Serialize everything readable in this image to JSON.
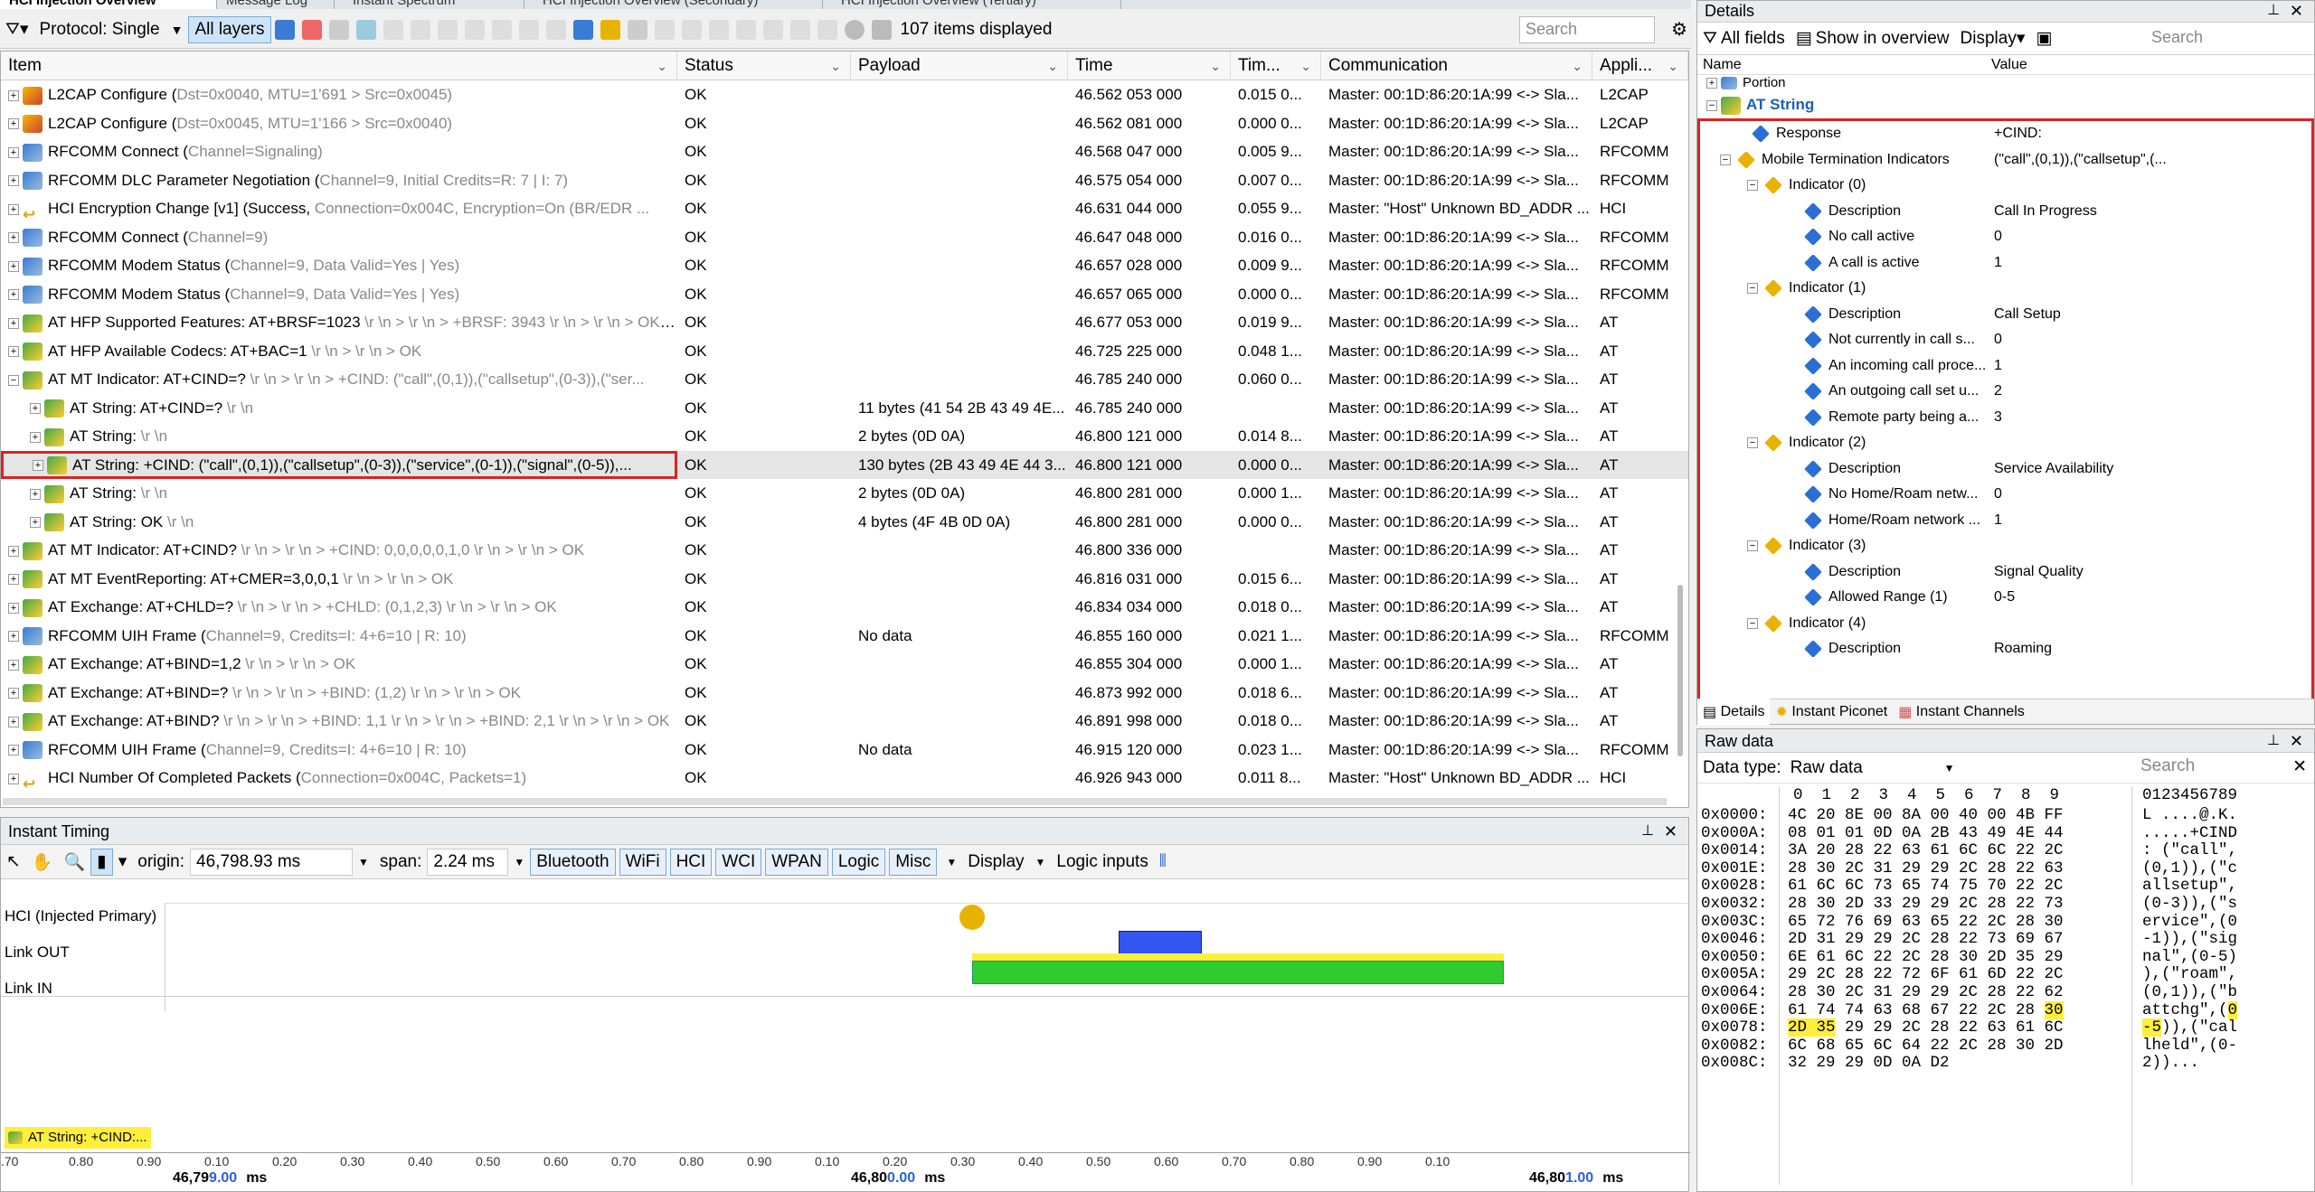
{
  "tabs": [
    "HCI Injection Overview",
    "Message Log",
    "Instant Spectrum",
    "HCI Injection Overview (Secondary)",
    "HCI Injection Overview (Tertiary)"
  ],
  "toolbar": {
    "protocol": "Protocol: Single",
    "all_layers": "All layers",
    "items_displayed": "107 items displayed",
    "search_placeholder": "Search"
  },
  "grid": {
    "headers": [
      "Item",
      "Status",
      "Payload",
      "Time",
      "Tim...",
      "Communication",
      "Appli..."
    ],
    "rows": [
      {
        "icon": "l2",
        "indent": 0,
        "item": "L2CAP Configure (",
        "params": "Dst=0x0040, MTU=1'691 > Src=0x0045)",
        "status": "OK",
        "payload": "",
        "time": "46.562 053 000",
        "delta": "0.015 0...",
        "comm": "Master: 00:1D:86:20:1A:99 <-> Sla...",
        "app": "L2CAP"
      },
      {
        "icon": "l2",
        "indent": 0,
        "item": "L2CAP Configure (",
        "params": "Dst=0x0045, MTU=1'166 > Src=0x0040)",
        "status": "OK",
        "payload": "",
        "time": "46.562 081 000",
        "delta": "0.000 0...",
        "comm": "Master: 00:1D:86:20:1A:99 <-> Sla...",
        "app": "L2CAP"
      },
      {
        "icon": "rf",
        "indent": 0,
        "item": "RFCOMM Connect (",
        "params": "Channel=Signaling)",
        "status": "OK",
        "payload": "",
        "time": "46.568 047 000",
        "delta": "0.005 9...",
        "comm": "Master: 00:1D:86:20:1A:99 <-> Sla...",
        "app": "RFCOMM"
      },
      {
        "icon": "rf",
        "indent": 0,
        "item": "RFCOMM DLC Parameter Negotiation (",
        "params": "Channel=9, Initial Credits=R: 7 | I: 7)",
        "status": "OK",
        "payload": "",
        "time": "46.575 054 000",
        "delta": "0.007 0...",
        "comm": "Master: 00:1D:86:20:1A:99 <-> Sla...",
        "app": "RFCOMM"
      },
      {
        "icon": "hci",
        "indent": 0,
        "item": "HCI Encryption Change [v1] (Success, ",
        "params": "Connection=0x004C, Encryption=On (BR/EDR ...",
        "status": "OK",
        "payload": "",
        "time": "46.631 044 000",
        "delta": "0.055 9...",
        "comm": "Master: \"Host\" Unknown BD_ADDR ...",
        "app": "HCI"
      },
      {
        "icon": "rf",
        "indent": 0,
        "item": "RFCOMM Connect (",
        "params": "Channel=9)",
        "status": "OK",
        "payload": "",
        "time": "46.647 048 000",
        "delta": "0.016 0...",
        "comm": "Master: 00:1D:86:20:1A:99 <-> Sla...",
        "app": "RFCOMM"
      },
      {
        "icon": "rf",
        "indent": 0,
        "item": "RFCOMM Modem Status (",
        "params": "Channel=9, Data Valid=Yes | Yes)",
        "status": "OK",
        "payload": "",
        "time": "46.657 028 000",
        "delta": "0.009 9...",
        "comm": "Master: 00:1D:86:20:1A:99 <-> Sla...",
        "app": "RFCOMM"
      },
      {
        "icon": "rf",
        "indent": 0,
        "item": "RFCOMM Modem Status (",
        "params": "Channel=9, Data Valid=Yes | Yes)",
        "status": "OK",
        "payload": "",
        "time": "46.657 065 000",
        "delta": "0.000 0...",
        "comm": "Master: 00:1D:86:20:1A:99 <-> Sla...",
        "app": "RFCOMM"
      },
      {
        "icon": "at",
        "indent": 0,
        "item": "AT HFP Supported Features: AT+BRSF=1023",
        "params": " \\r \\n > \\r \\n > +BRSF: 3943 \\r \\n > \\r \\n > OK \\r \\n",
        "status": "OK",
        "payload": "",
        "time": "46.677 053 000",
        "delta": "0.019 9...",
        "comm": "Master: 00:1D:86:20:1A:99 <-> Sla...",
        "app": "AT"
      },
      {
        "icon": "at",
        "indent": 0,
        "item": "AT HFP Available Codecs: AT+BAC=1",
        "params": " \\r \\n > \\r \\n > OK",
        "status": "OK",
        "payload": "",
        "time": "46.725 225 000",
        "delta": "0.048 1...",
        "comm": "Master: 00:1D:86:20:1A:99 <-> Sla...",
        "app": "AT"
      },
      {
        "icon": "at",
        "indent": 0,
        "item": "AT MT Indicator: AT+CIND=?",
        "params": " \\r \\n > \\r \\n > +CIND: (\"call\",(0,1)),(\"callsetup\",(0-3)),(\"ser...",
        "status": "OK",
        "payload": "",
        "time": "46.785 240 000",
        "delta": "0.060 0...",
        "comm": "Master: 00:1D:86:20:1A:99 <-> Sla...",
        "app": "AT"
      },
      {
        "icon": "at",
        "indent": 1,
        "item": "AT String: AT+CIND=?",
        "params": " \\r \\n",
        "status": "OK",
        "payload": "11 bytes (41 54 2B 43 49 4E...",
        "time": "46.785 240 000",
        "delta": "",
        "comm": "Master: 00:1D:86:20:1A:99 <-> Sla...",
        "app": "AT"
      },
      {
        "icon": "at",
        "indent": 1,
        "item": "AT String:",
        "params": " \\r \\n",
        "status": "OK",
        "payload": "2 bytes (0D 0A)",
        "time": "46.800 121 000",
        "delta": "0.014 8...",
        "comm": "Master: 00:1D:86:20:1A:99 <-> Sla...",
        "app": "AT"
      },
      {
        "icon": "at",
        "indent": 1,
        "item": "AT String: +CIND: (\"call\",(0,1)),(\"callsetup\",(0-3)),(\"service\",(0-1)),(\"signal\",(0-5)),...",
        "params": "",
        "status": "OK",
        "payload": "130 bytes (2B 43 49 4E 44 3...",
        "time": "46.800 121 000",
        "delta": "0.000 0...",
        "comm": "Master: 00:1D:86:20:1A:99 <-> Sla...",
        "app": "AT",
        "selected": true
      },
      {
        "icon": "at",
        "indent": 1,
        "item": "AT String:",
        "params": " \\r \\n",
        "status": "OK",
        "payload": "2 bytes (0D 0A)",
        "time": "46.800 281 000",
        "delta": "0.000 1...",
        "comm": "Master: 00:1D:86:20:1A:99 <-> Sla...",
        "app": "AT"
      },
      {
        "icon": "at",
        "indent": 1,
        "item": "AT String: OK",
        "params": " \\r \\n",
        "status": "OK",
        "payload": "4 bytes (4F 4B 0D 0A)",
        "time": "46.800 281 000",
        "delta": "0.000 0...",
        "comm": "Master: 00:1D:86:20:1A:99 <-> Sla...",
        "app": "AT"
      },
      {
        "icon": "at",
        "indent": 0,
        "item": "AT MT Indicator: AT+CIND?",
        "params": " \\r \\n > \\r \\n > +CIND: 0,0,0,0,0,1,0 \\r \\n > \\r \\n > OK",
        "status": "OK",
        "payload": "",
        "time": "46.800 336 000",
        "delta": "",
        "comm": "Master: 00:1D:86:20:1A:99 <-> Sla...",
        "app": "AT"
      },
      {
        "icon": "at",
        "indent": 0,
        "item": "AT MT EventReporting: AT+CMER=3,0,0,1",
        "params": " \\r \\n > \\r \\n > OK",
        "status": "OK",
        "payload": "",
        "time": "46.816 031 000",
        "delta": "0.015 6...",
        "comm": "Master: 00:1D:86:20:1A:99 <-> Sla...",
        "app": "AT"
      },
      {
        "icon": "at",
        "indent": 0,
        "item": "AT Exchange: AT+CHLD=?",
        "params": " \\r \\n > \\r \\n > +CHLD: (0,1,2,3) \\r \\n > \\r \\n > OK",
        "status": "OK",
        "payload": "",
        "time": "46.834 034 000",
        "delta": "0.018 0...",
        "comm": "Master: 00:1D:86:20:1A:99 <-> Sla...",
        "app": "AT"
      },
      {
        "icon": "rf",
        "indent": 0,
        "item": "RFCOMM UIH Frame (",
        "params": "Channel=9, Credits=I: 4+6=10 | R: 10)",
        "status": "OK",
        "payload": "No data",
        "time": "46.855 160 000",
        "delta": "0.021 1...",
        "comm": "Master: 00:1D:86:20:1A:99 <-> Sla...",
        "app": "RFCOMM"
      },
      {
        "icon": "at",
        "indent": 0,
        "item": "AT Exchange: AT+BIND=1,2",
        "params": " \\r \\n > \\r \\n > OK",
        "status": "OK",
        "payload": "",
        "time": "46.855 304 000",
        "delta": "0.000 1...",
        "comm": "Master: 00:1D:86:20:1A:99 <-> Sla...",
        "app": "AT"
      },
      {
        "icon": "at",
        "indent": 0,
        "item": "AT Exchange: AT+BIND=?",
        "params": " \\r \\n > \\r \\n > +BIND: (1,2) \\r \\n > \\r \\n > OK",
        "status": "OK",
        "payload": "",
        "time": "46.873 992 000",
        "delta": "0.018 6...",
        "comm": "Master: 00:1D:86:20:1A:99 <-> Sla...",
        "app": "AT"
      },
      {
        "icon": "at",
        "indent": 0,
        "item": "AT Exchange: AT+BIND?",
        "params": " \\r \\n > \\r \\n > +BIND: 1,1 \\r \\n > \\r \\n > +BIND: 2,1 \\r \\n > \\r \\n > OK",
        "status": "OK",
        "payload": "",
        "time": "46.891 998 000",
        "delta": "0.018 0...",
        "comm": "Master: 00:1D:86:20:1A:99 <-> Sla...",
        "app": "AT"
      },
      {
        "icon": "rf",
        "indent": 0,
        "item": "RFCOMM UIH Frame (",
        "params": "Channel=9, Credits=I: 4+6=10 | R: 10)",
        "status": "OK",
        "payload": "No data",
        "time": "46.915 120 000",
        "delta": "0.023 1...",
        "comm": "Master: 00:1D:86:20:1A:99 <-> Sla...",
        "app": "RFCOMM"
      },
      {
        "icon": "hci",
        "indent": 0,
        "item": "HCI Number Of Completed Packets (",
        "params": "Connection=0x004C, Packets=1)",
        "status": "OK",
        "payload": "",
        "time": "46.926 943 000",
        "delta": "0.011 8...",
        "comm": "Master: \"Host\" Unknown BD_ADDR ...",
        "app": "HCI"
      }
    ]
  },
  "timing": {
    "title": "Instant Timing",
    "origin_label": "origin:",
    "origin_value": "46,798.93 ms",
    "span_label": "span:",
    "span_value": "2.24 ms",
    "buttons": [
      "Bluetooth",
      "WiFi",
      "HCI",
      "WCI",
      "WPAN",
      "Logic",
      "Misc"
    ],
    "display": "Display",
    "logic_inputs": "Logic inputs",
    "lanes": [
      "HCI (Injected Primary)",
      "Link OUT",
      "Link IN"
    ],
    "tag": "AT String: +CIND:...",
    "ticks": [
      ".70",
      "0.80",
      "0.90",
      "0.10",
      "0.20",
      "0.30",
      "0.40",
      "0.50",
      "0.60",
      "0.70",
      "0.80",
      "0.90",
      "0.10",
      "0.20",
      "0.30",
      "0.40",
      "0.50",
      "0.60",
      "0.70",
      "0.80",
      "0.90",
      "0.10"
    ],
    "major": [
      {
        "prefix": "46,79",
        "suffix": "9.00",
        "unit": "ms"
      },
      {
        "prefix": "46,80",
        "suffix": "0.00",
        "unit": "ms"
      },
      {
        "prefix": "46,80",
        "suffix": "1.00",
        "unit": "ms"
      }
    ]
  },
  "details": {
    "title": "Details",
    "all_fields": "All fields",
    "show_overview": "Show in overview",
    "display": "Display",
    "search_placeholder": "Search",
    "col_name": "Name",
    "col_value": "Value",
    "portion": "Portion",
    "root": "AT String",
    "tree": [
      {
        "level": 1,
        "expander": "",
        "name": "Response",
        "value": "+CIND:"
      },
      {
        "level": 1,
        "expander": "-",
        "name": "Mobile Termination Indicators",
        "value": "(\"call\",(0,1)),(\"callsetup\",(..."
      },
      {
        "level": 2,
        "expander": "-",
        "name": "Indicator (0)",
        "value": ""
      },
      {
        "level": 3,
        "expander": "",
        "name": "Description",
        "value": "Call In Progress"
      },
      {
        "level": 3,
        "expander": "",
        "name": "No call active",
        "value": "0"
      },
      {
        "level": 3,
        "expander": "",
        "name": "A call is active",
        "value": "1"
      },
      {
        "level": 2,
        "expander": "-",
        "name": "Indicator (1)",
        "value": ""
      },
      {
        "level": 3,
        "expander": "",
        "name": "Description",
        "value": "Call Setup"
      },
      {
        "level": 3,
        "expander": "",
        "name": "Not currently in call s...",
        "value": "0"
      },
      {
        "level": 3,
        "expander": "",
        "name": "An incoming call proce...",
        "value": "1"
      },
      {
        "level": 3,
        "expander": "",
        "name": "An outgoing call set u...",
        "value": "2"
      },
      {
        "level": 3,
        "expander": "",
        "name": "Remote party being a...",
        "value": "3"
      },
      {
        "level": 2,
        "expander": "-",
        "name": "Indicator (2)",
        "value": ""
      },
      {
        "level": 3,
        "expander": "",
        "name": "Description",
        "value": "Service Availability"
      },
      {
        "level": 3,
        "expander": "",
        "name": "No Home/Roam netw...",
        "value": "0"
      },
      {
        "level": 3,
        "expander": "",
        "name": "Home/Roam network ...",
        "value": "1"
      },
      {
        "level": 2,
        "expander": "-",
        "name": "Indicator (3)",
        "value": ""
      },
      {
        "level": 3,
        "expander": "",
        "name": "Description",
        "value": "Signal Quality"
      },
      {
        "level": 3,
        "expander": "",
        "name": "Allowed Range (1)",
        "value": "0-5"
      },
      {
        "level": 2,
        "expander": "-",
        "name": "Indicator (4)",
        "value": ""
      },
      {
        "level": 3,
        "expander": "",
        "name": "Description",
        "value": "Roaming"
      }
    ],
    "bottom_tabs": [
      "Details",
      "Instant Piconet",
      "Instant Channels"
    ]
  },
  "raw": {
    "title": "Raw data",
    "data_type_label": "Data type:",
    "data_type_value": "Raw data",
    "search_placeholder": "Search",
    "hex_header": "0  1  2  3  4  5  6  7  8  9",
    "ascii_header": "0123456789",
    "rows": [
      {
        "addr": "0x0000:",
        "hex": "4C 20 8E 00 8A 00 40 00 4B FF",
        "ascii": "L ....@.K."
      },
      {
        "addr": "0x000A:",
        "hex": "08 01 01 0D 0A 2B 43 49 4E 44",
        "ascii": ".....+CIND"
      },
      {
        "addr": "0x0014:",
        "hex": "3A 20 28 22 63 61 6C 6C 22 2C",
        "ascii": ": (\"call\","
      },
      {
        "addr": "0x001E:",
        "hex": "28 30 2C 31 29 29 2C 28 22 63",
        "ascii": "(0,1)),(\"c"
      },
      {
        "addr": "0x0028:",
        "hex": "61 6C 6C 73 65 74 75 70 22 2C",
        "ascii": "allsetup\","
      },
      {
        "addr": "0x0032:",
        "hex": "28 30 2D 33 29 29 2C 28 22 73",
        "ascii": "(0-3)),(\"s"
      },
      {
        "addr": "0x003C:",
        "hex": "65 72 76 69 63 65 22 2C 28 30",
        "ascii": "ervice\",(0"
      },
      {
        "addr": "0x0046:",
        "hex": "2D 31 29 29 2C 28 22 73 69 67",
        "ascii": "-1)),(\"sig"
      },
      {
        "addr": "0x0050:",
        "hex": "6E 61 6C 22 2C 28 30 2D 35 29",
        "ascii": "nal\",(0-5)"
      },
      {
        "addr": "0x005A:",
        "hex": "29 2C 28 22 72 6F 61 6D 22 2C",
        "ascii": "),(\"roam\","
      },
      {
        "addr": "0x0064:",
        "hex": "28 30 2C 31 29 29 2C 28 22 62",
        "ascii": "(0,1)),(\"b"
      },
      {
        "addr": "0x006E:",
        "hex": "61 74 74 63 68 67 22 2C 28 ",
        "hexhl": "30",
        "ascii": "attchg\",(",
        "asciihl": "0"
      },
      {
        "addr": "0x0078:",
        "hexhl0": "2D 35",
        "hex": " 29 29 2C 28 22 63 61 6C",
        "asciihl0": "-5",
        "ascii": ")),(\"cal"
      },
      {
        "addr": "0x0082:",
        "hex": "6C 68 65 6C 64 22 2C 28 30 2D",
        "ascii": "lheld\",(0-"
      },
      {
        "addr": "0x008C:",
        "hex": "32 29 29 0D 0A D2",
        "ascii": "2))..."
      }
    ]
  }
}
